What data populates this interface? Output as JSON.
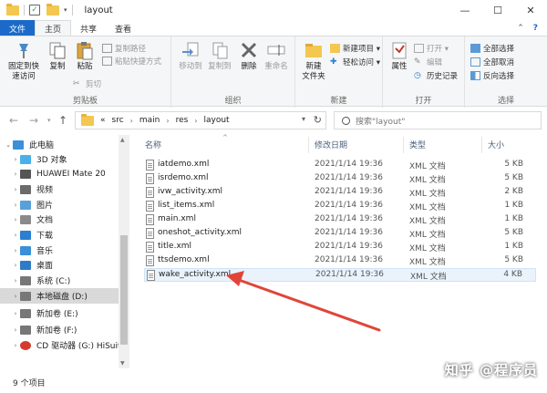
{
  "window": {
    "title": "layout",
    "controls": {
      "minimize": "—",
      "maximize": "☐",
      "close": "✕"
    }
  },
  "ribbon_tabs": [
    "文件",
    "主页",
    "共享",
    "查看"
  ],
  "ribbon": {
    "clipboard": {
      "label": "剪贴板",
      "pin": "固定到快\n速访问",
      "copy": "复制",
      "paste": "粘贴",
      "cut": "剪切",
      "copy_path": "复制路径",
      "paste_shortcut": "粘贴快捷方式"
    },
    "organize": {
      "label": "组织",
      "move_to": "移动到",
      "copy_to": "复制到",
      "delete": "删除",
      "rename": "重命名"
    },
    "new": {
      "label": "新建",
      "new_folder": "新建\n文件夹",
      "new_item": "新建项目 ▾",
      "easy_access": "轻松访问 ▾"
    },
    "open": {
      "label": "打开",
      "properties": "属性",
      "open": "打开 ▾",
      "edit": "编辑",
      "history": "历史记录"
    },
    "select": {
      "label": "选择",
      "select_all": "全部选择",
      "select_none": "全部取消",
      "invert": "反向选择"
    }
  },
  "address": {
    "prefix": "«",
    "crumbs": [
      "src",
      "main",
      "res",
      "layout"
    ]
  },
  "search": {
    "placeholder": "搜索\"layout\""
  },
  "nav_pane": [
    {
      "label": "此电脑",
      "icon": "computer-icon",
      "color": "#3c8fd8"
    },
    {
      "label": "3D 对象",
      "icon": "cube-icon",
      "color": "#4ab1e8"
    },
    {
      "label": "HUAWEI Mate 20",
      "icon": "phone-icon",
      "color": "#555555"
    },
    {
      "label": "视频",
      "icon": "video-icon",
      "color": "#6b6b6b"
    },
    {
      "label": "图片",
      "icon": "picture-icon",
      "color": "#5aa0d8"
    },
    {
      "label": "文档",
      "icon": "document-icon",
      "color": "#8a8a8a"
    },
    {
      "label": "下载",
      "icon": "download-icon",
      "color": "#2a7fd0"
    },
    {
      "label": "音乐",
      "icon": "music-icon",
      "color": "#3a90d8"
    },
    {
      "label": "桌面",
      "icon": "desktop-icon",
      "color": "#2e7cc8"
    },
    {
      "label": "系统 (C:)",
      "icon": "drive-icon",
      "color": "#777777"
    },
    {
      "label": "本地磁盘 (D:)",
      "icon": "drive-icon",
      "color": "#777777"
    },
    {
      "label": "新加卷 (E:)",
      "icon": "drive-icon",
      "color": "#777777"
    },
    {
      "label": "新加卷 (F:)",
      "icon": "drive-icon",
      "color": "#777777"
    },
    {
      "label": "CD 驱动器 (G:) HiSuite",
      "icon": "cd-icon",
      "color": "#d13b2f"
    }
  ],
  "columns": {
    "name": "名称",
    "date": "修改日期",
    "type": "类型",
    "size": "大小"
  },
  "files": [
    {
      "name": "iatdemo.xml",
      "date": "2021/1/14 19:36",
      "type": "XML 文档",
      "size": "5 KB"
    },
    {
      "name": "isrdemo.xml",
      "date": "2021/1/14 19:36",
      "type": "XML 文档",
      "size": "5 KB"
    },
    {
      "name": "ivw_activity.xml",
      "date": "2021/1/14 19:36",
      "type": "XML 文档",
      "size": "2 KB"
    },
    {
      "name": "list_items.xml",
      "date": "2021/1/14 19:36",
      "type": "XML 文档",
      "size": "1 KB"
    },
    {
      "name": "main.xml",
      "date": "2021/1/14 19:36",
      "type": "XML 文档",
      "size": "1 KB"
    },
    {
      "name": "oneshot_activity.xml",
      "date": "2021/1/14 19:36",
      "type": "XML 文档",
      "size": "5 KB"
    },
    {
      "name": "title.xml",
      "date": "2021/1/14 19:36",
      "type": "XML 文档",
      "size": "1 KB"
    },
    {
      "name": "ttsdemo.xml",
      "date": "2021/1/14 19:36",
      "type": "XML 文档",
      "size": "5 KB"
    },
    {
      "name": "wake_activity.xml",
      "date": "2021/1/14 19:36",
      "type": "XML 文档",
      "size": "4 KB"
    }
  ],
  "status": {
    "item_count": "9 个项目"
  },
  "watermark": "知乎 @程序员",
  "colors": {
    "accent": "#1b6ac9",
    "annotation_arrow": "#e0453a",
    "selection": "#eaf3fc"
  }
}
